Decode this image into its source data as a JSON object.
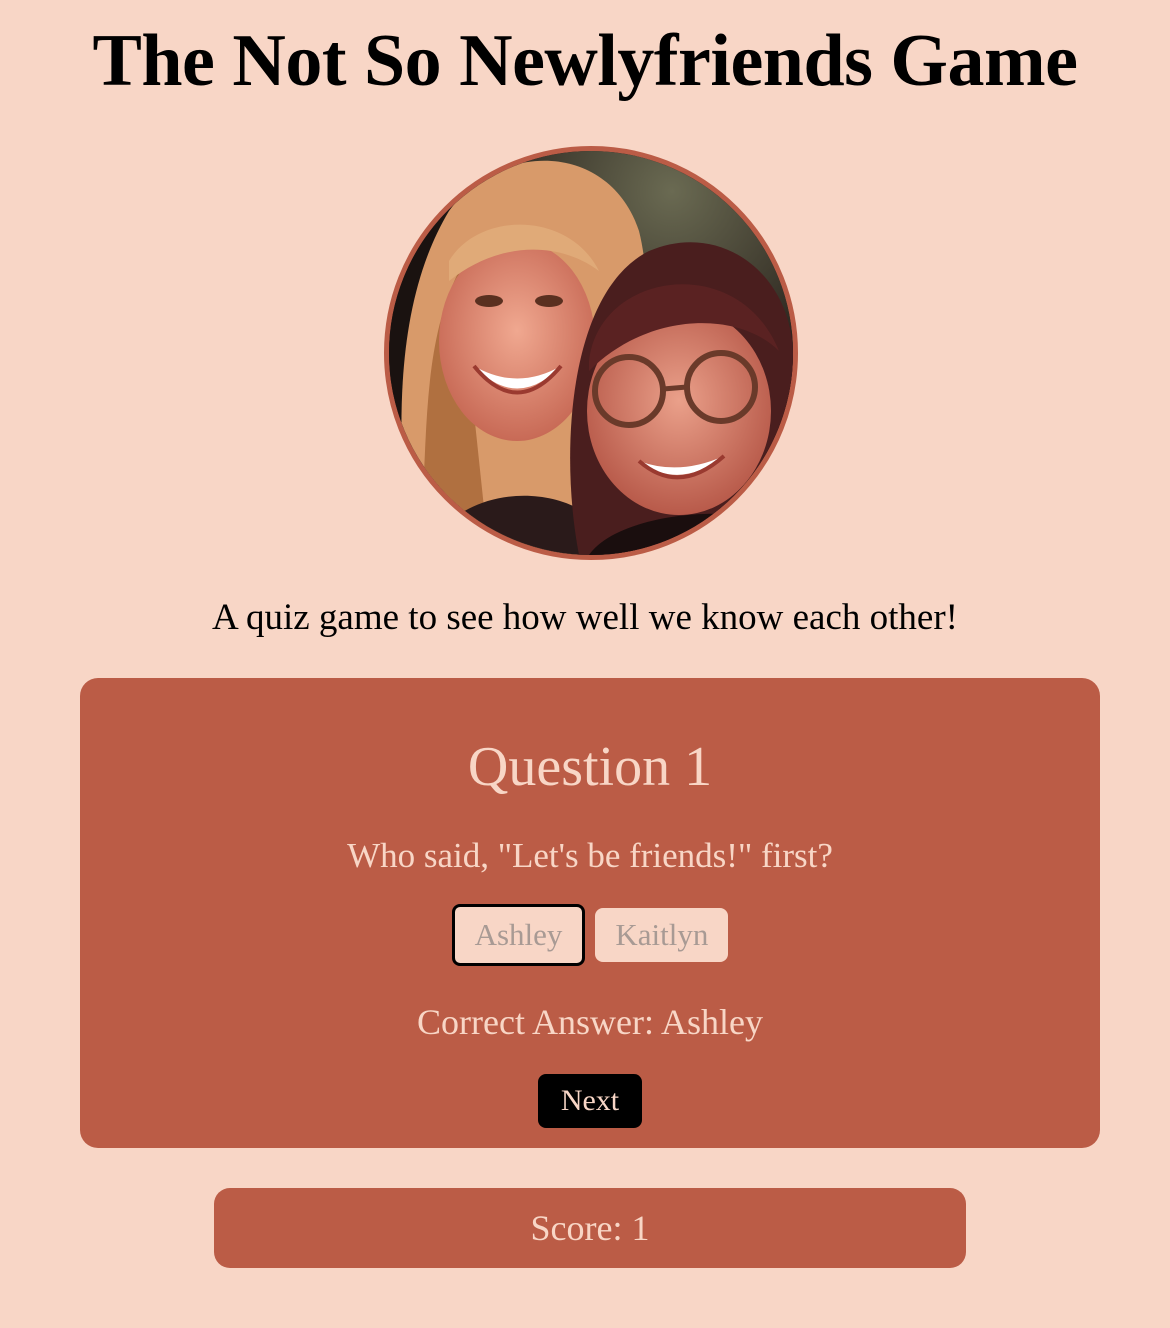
{
  "header": {
    "title": "The Not So Newlyfriends Game"
  },
  "hero": {
    "image": "photo of two friends smiling",
    "subtitle": "A quiz game to see how well we know each other!"
  },
  "quiz": {
    "question_title": "Question 1",
    "question_text": "Who said, \"Let's be friends!\" first?",
    "answers": [
      {
        "label": "Ashley",
        "selected": true
      },
      {
        "label": "Kaitlyn",
        "selected": false
      }
    ],
    "correct_answer_text": "Correct Answer: Ashley",
    "next_label": "Next"
  },
  "score": {
    "text": "Score: 1"
  },
  "colors": {
    "background": "#f8d6c6",
    "accent": "#bb5c46",
    "button_dark": "#000000"
  }
}
